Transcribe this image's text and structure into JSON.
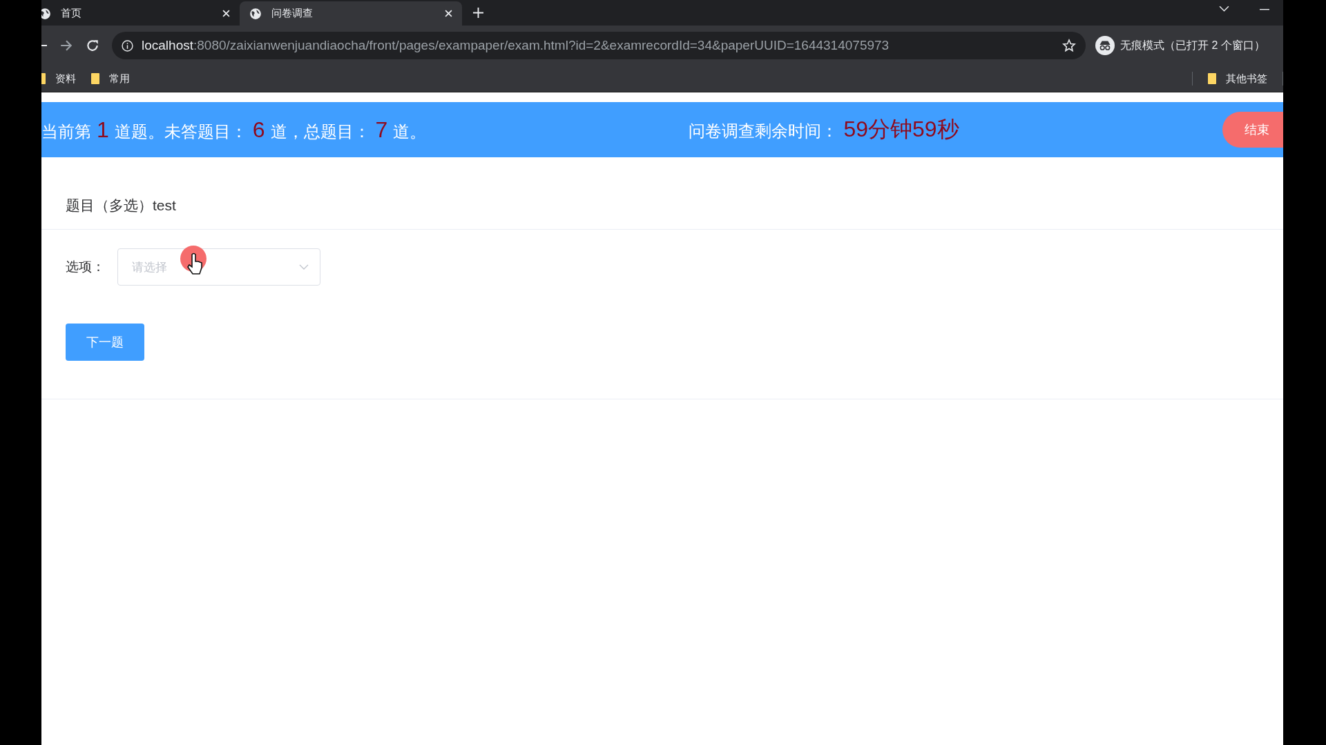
{
  "browser": {
    "tabs": [
      {
        "label": "首页",
        "selected": false
      },
      {
        "label": "问卷调查",
        "selected": true
      }
    ],
    "address": {
      "host": "localhost",
      "rest": ":8080/zaixianwenjuandiaocha/front/pages/exampaper/exam.html?id=2&examrecordId=34&paperUUID=1644314075973"
    },
    "incognito": "无痕模式（已打开 2 个窗口）",
    "bookmarks": [
      "资料",
      "常用"
    ],
    "other_bookmarks": "其他书签"
  },
  "banner": {
    "progress": [
      {
        "kind": "text",
        "text": "当前第"
      },
      {
        "kind": "number",
        "text": "1"
      },
      {
        "kind": "text",
        "text": "道题。未答题目："
      },
      {
        "kind": "number",
        "text": "6"
      },
      {
        "kind": "text",
        "text": "道，总题目："
      },
      {
        "kind": "number",
        "text": "7"
      },
      {
        "kind": "text",
        "text": "道。"
      }
    ],
    "timer_label": "问卷调查剩余时间：",
    "timer_value": "59分钟59秒",
    "end_button": "结束"
  },
  "question": {
    "title": "题目（多选）test",
    "field_label": "选项：",
    "select": {
      "placeholder": "请选择"
    },
    "next_button": "下一题"
  }
}
